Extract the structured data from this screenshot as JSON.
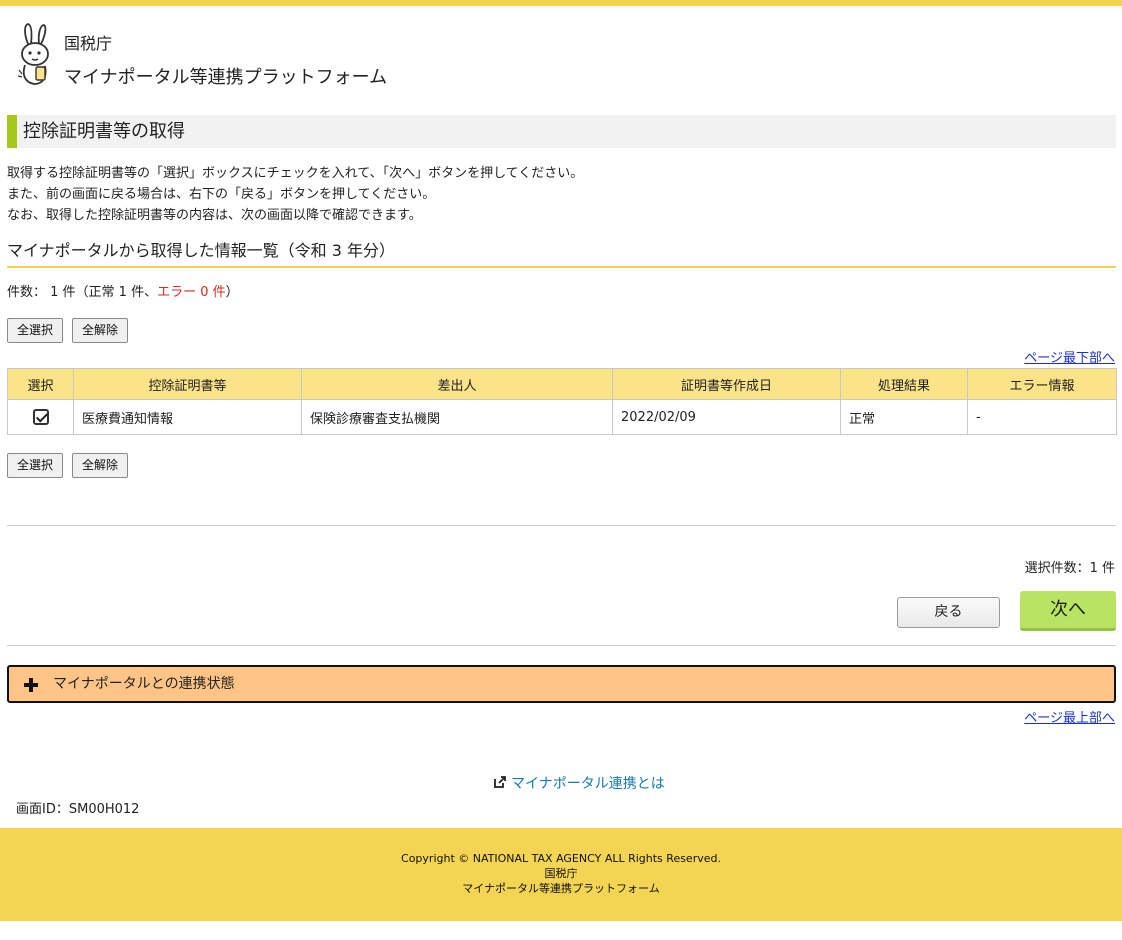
{
  "header": {
    "agency": "国税庁",
    "platform": "マイナポータル等連携プラットフォーム"
  },
  "page": {
    "title": "控除証明書等の取得",
    "description": [
      "取得する控除証明書等の「選択」ボックスにチェックを入れて、「次へ」ボタンを押してください。",
      "また、前の画面に戻る場合は、右下の「戻る」ボタンを押してください。",
      "なお、取得した控除証明書等の内容は、次の画面以降で確認できます。"
    ]
  },
  "list": {
    "section_title": "マイナポータルから取得した情報一覧（令和 3 年分）",
    "count_prefix": "件数： 1 件（正常 1 件、",
    "count_error": "エラー 0 件",
    "count_suffix": "）",
    "select_all": "全選択",
    "deselect_all": "全解除",
    "to_bottom": "ページ最下部へ",
    "to_top": "ページ最上部へ",
    "columns": [
      "選択",
      "控除証明書等",
      "差出人",
      "証明書等作成日",
      "処理結果",
      "エラー情報"
    ],
    "rows": [
      {
        "selected": true,
        "document": "医療費通知情報",
        "sender": "保険診療審査支払機関",
        "date": "2022/02/09",
        "result": "正常",
        "error": "-"
      }
    ]
  },
  "actions": {
    "selected_count": "選択件数：1 件",
    "back": "戻る",
    "next": "次へ"
  },
  "accordion": {
    "label": "マイナポータルとの連携状態"
  },
  "links": {
    "about": "マイナポータル連携とは"
  },
  "screen_id": "画面ID：SM00H012",
  "footer": {
    "copyright": "Copyright © NATIONAL TAX AGENCY ALL Rights Reserved.",
    "agency": "国税庁",
    "platform": "マイナポータル等連携プラットフォーム"
  },
  "colors": {
    "accent_yellow": "#f4d44e",
    "heading_bar_green": "#a6c81c",
    "next_button_green": "#b9e463",
    "accordion_orange": "#ffc486",
    "table_header": "#fbe388",
    "error_red": "#d52b1e",
    "link_blue": "#1a32d0"
  }
}
